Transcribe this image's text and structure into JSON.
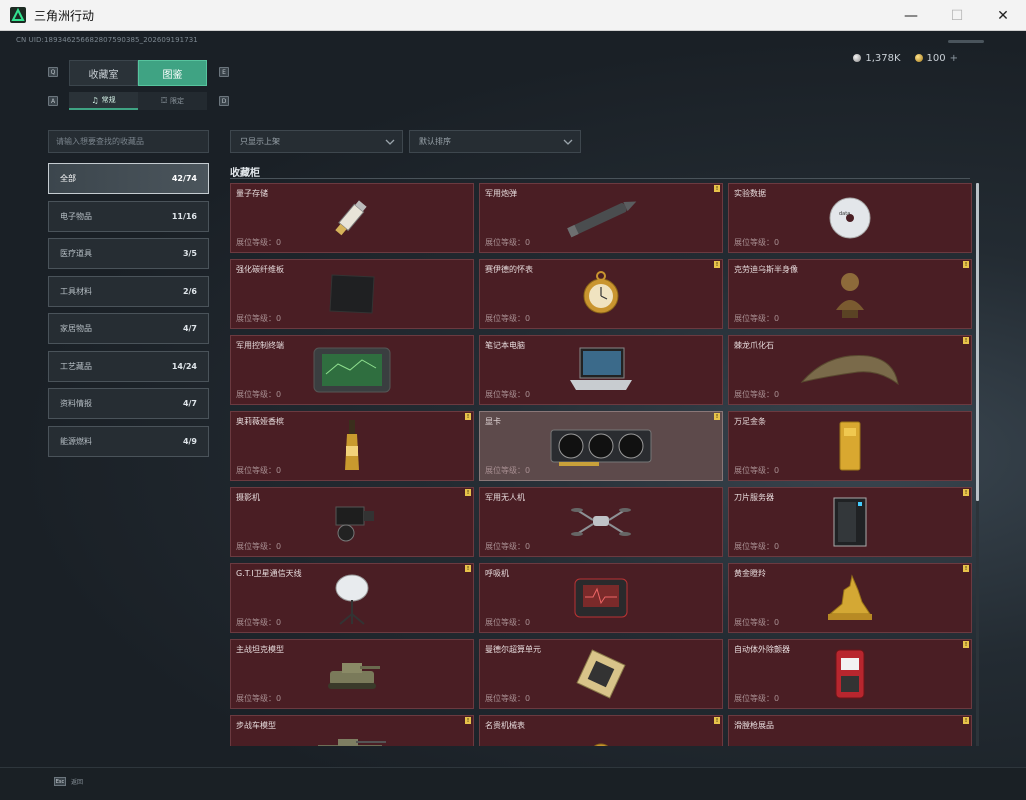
{
  "window": {
    "title": "三角洲行动",
    "controls": [
      "—",
      "☐",
      "✕"
    ]
  },
  "header": {
    "uid": "CN UID:1893462566828075903​85_20260919173​1",
    "currency": [
      {
        "icon": "silver-coin-icon",
        "value": "1,378K"
      },
      {
        "icon": "gold-coin-icon",
        "value": "100"
      }
    ],
    "plus": "+"
  },
  "tabs": {
    "left_key": "Q",
    "right_key": "E",
    "items": [
      {
        "label": "收藏室",
        "active": false
      },
      {
        "label": "图鉴",
        "active": true
      }
    ]
  },
  "subtabs": {
    "left_key": "A",
    "right_key": "D",
    "items": [
      {
        "label": "常规",
        "icon": "♫",
        "active": true
      },
      {
        "label": "限定",
        "icon": "⛋",
        "active": false
      }
    ]
  },
  "search": {
    "placeholder": "请输入想要查找的收藏品",
    "value": ""
  },
  "filters": {
    "shelf": "只显示上架",
    "sort": "默认排序"
  },
  "categories": [
    {
      "label": "全部",
      "count": "42/74",
      "active": true
    },
    {
      "label": "电子物品",
      "count": "11/16",
      "active": false
    },
    {
      "label": "医疗道具",
      "count": "3/5",
      "active": false
    },
    {
      "label": "工具材料",
      "count": "2/6",
      "active": false
    },
    {
      "label": "家居物品",
      "count": "4/7",
      "active": false
    },
    {
      "label": "工艺藏品",
      "count": "14/24",
      "active": false
    },
    {
      "label": "资料情报",
      "count": "4/7",
      "active": false
    },
    {
      "label": "能源燃料",
      "count": "4/9",
      "active": false
    }
  ],
  "section": {
    "title": "收藏柜"
  },
  "level_label": "展位等级：0",
  "items": [
    {
      "name": "量子存储",
      "flag": false,
      "icon": "usb-drive-icon"
    },
    {
      "name": "军用炮弹",
      "flag": true,
      "icon": "artillery-shell-icon"
    },
    {
      "name": "实验数据",
      "flag": false,
      "icon": "cd-disc-icon"
    },
    {
      "name": "强化碳纤维板",
      "flag": false,
      "icon": "carbon-plate-icon"
    },
    {
      "name": "赛伊德的怀表",
      "flag": true,
      "icon": "pocket-watch-icon"
    },
    {
      "name": "克劳迪乌斯半身像",
      "flag": true,
      "icon": "bust-statue-icon"
    },
    {
      "name": "军用控制终端",
      "flag": false,
      "icon": "control-terminal-icon"
    },
    {
      "name": "笔记本电脑",
      "flag": false,
      "icon": "laptop-icon"
    },
    {
      "name": "棘龙爪化石",
      "flag": true,
      "icon": "claw-fossil-icon"
    },
    {
      "name": "奥莉薇娅香槟",
      "flag": true,
      "icon": "champagne-bottle-icon"
    },
    {
      "name": "显卡",
      "flag": true,
      "icon": "graphics-card-icon",
      "highlight": true
    },
    {
      "name": "万足金条",
      "flag": false,
      "icon": "gold-bar-icon"
    },
    {
      "name": "摄影机",
      "flag": true,
      "icon": "camera-icon"
    },
    {
      "name": "军用无人机",
      "flag": false,
      "icon": "drone-icon"
    },
    {
      "name": "刀片服务器",
      "flag": true,
      "icon": "server-icon"
    },
    {
      "name": "G.T.I卫星通信天线",
      "flag": true,
      "icon": "satellite-dish-icon"
    },
    {
      "name": "呼吸机",
      "flag": false,
      "icon": "ventilator-icon"
    },
    {
      "name": "黄金瞪羚",
      "flag": true,
      "icon": "gold-gazelle-icon"
    },
    {
      "name": "主战坦克模型",
      "flag": false,
      "icon": "tank-model-icon"
    },
    {
      "name": "曼德尔超算单元",
      "flag": false,
      "icon": "cpu-unit-icon"
    },
    {
      "name": "自动体外除颤器",
      "flag": true,
      "icon": "defibrillator-icon"
    },
    {
      "name": "步战车模型",
      "flag": true,
      "icon": "ifv-model-icon"
    },
    {
      "name": "名贵机械表",
      "flag": true,
      "icon": "wristwatch-icon"
    },
    {
      "name": "滑膛枪展品",
      "flag": true,
      "icon": "musket-icon"
    }
  ],
  "footer": {
    "key": "Esc",
    "label": "返回"
  }
}
